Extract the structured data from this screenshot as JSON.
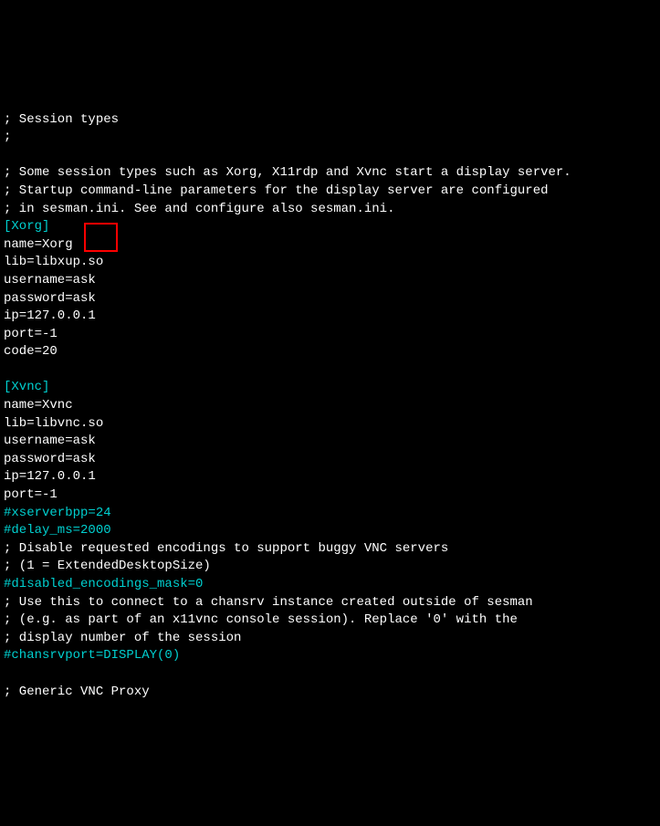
{
  "lines": [
    {
      "text": "; Session types",
      "class": "white"
    },
    {
      "text": ";",
      "class": "white"
    },
    {
      "text": "",
      "class": "white"
    },
    {
      "text": "; Some session types such as Xorg, X11rdp and Xvnc start a display server.",
      "class": "white"
    },
    {
      "text": "; Startup command-line parameters for the display server are configured",
      "class": "white"
    },
    {
      "text": "; in sesman.ini. See and configure also sesman.ini.",
      "class": "white"
    },
    {
      "text": "[Xorg]",
      "class": "teal"
    },
    {
      "text": "name=Xorg",
      "class": "white"
    },
    {
      "text": "lib=libxup.so",
      "class": "white"
    },
    {
      "text": "username=ask",
      "class": "white"
    },
    {
      "text": "password=ask",
      "class": "white"
    },
    {
      "text": "ip=127.0.0.1",
      "class": "white"
    },
    {
      "text": "port=-1",
      "class": "white"
    },
    {
      "text": "code=20",
      "class": "white"
    },
    {
      "text": "",
      "class": "white"
    },
    {
      "text": "[Xvnc]",
      "class": "teal"
    },
    {
      "text": "name=Xvnc",
      "class": "white"
    },
    {
      "text": "lib=libvnc.so",
      "class": "white"
    },
    {
      "text": "username=ask",
      "class": "white"
    },
    {
      "text": "password=ask",
      "class": "white"
    },
    {
      "text": "ip=127.0.0.1",
      "class": "white"
    },
    {
      "text": "port=-1",
      "class": "white"
    },
    {
      "text": "#xserverbpp=24",
      "class": "teal"
    },
    {
      "text": "#delay_ms=2000",
      "class": "teal"
    },
    {
      "text": "; Disable requested encodings to support buggy VNC servers",
      "class": "white"
    },
    {
      "text": "; (1 = ExtendedDesktopSize)",
      "class": "white"
    },
    {
      "text": "#disabled_encodings_mask=0",
      "class": "teal"
    },
    {
      "text": "; Use this to connect to a chansrv instance created outside of sesman",
      "class": "white"
    },
    {
      "text": "; (e.g. as part of an x11vnc console session). Replace '0' with the",
      "class": "white"
    },
    {
      "text": "; display number of the session",
      "class": "white"
    },
    {
      "text": "#chansrvport=DISPLAY(0)",
      "class": "teal"
    },
    {
      "text": "",
      "class": "white"
    },
    {
      "text": "; Generic VNC Proxy",
      "class": "white"
    }
  ]
}
